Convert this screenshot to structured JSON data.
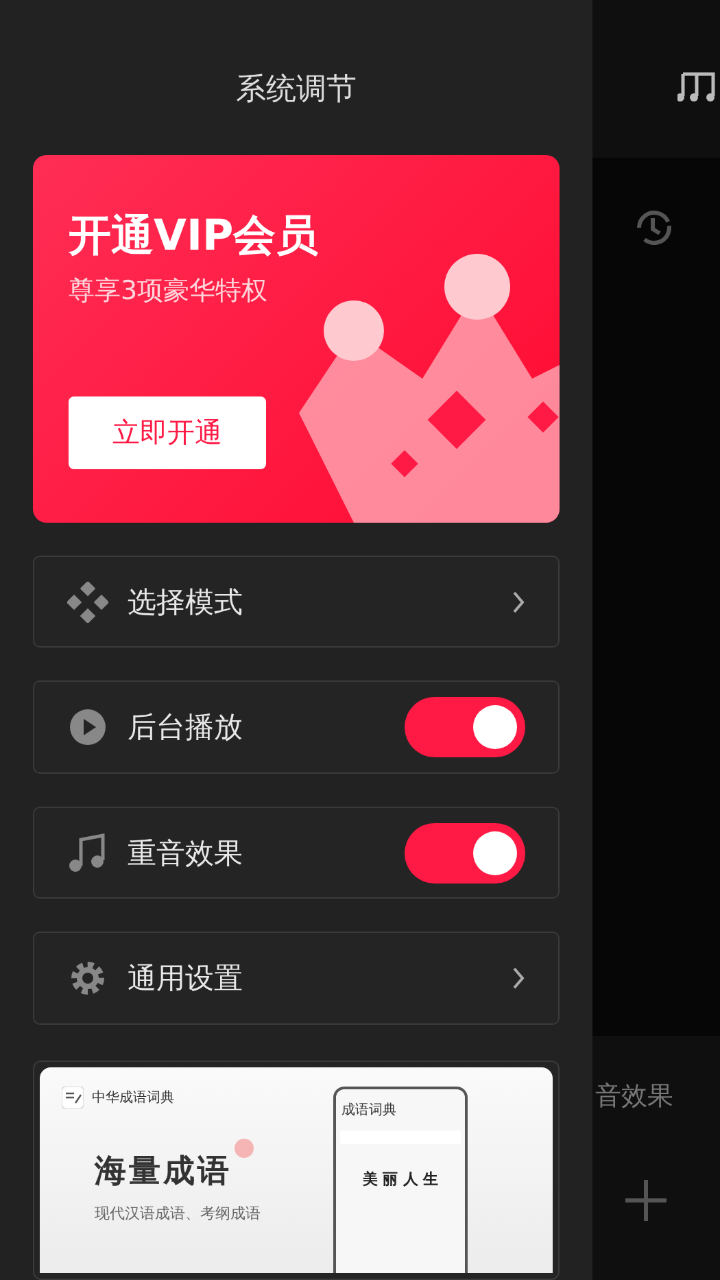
{
  "drawer": {
    "title": "系统调节",
    "vip": {
      "title": "开通VIP会员",
      "subtitle": "尊享3项豪华特权",
      "button": "立即开通"
    },
    "items": [
      {
        "kind": "chevron",
        "label": "选择模式"
      },
      {
        "kind": "toggle",
        "label": "后台播放",
        "on": true
      },
      {
        "kind": "toggle",
        "label": "重音效果",
        "on": true
      },
      {
        "kind": "chevron",
        "label": "通用设置"
      }
    ],
    "ad": {
      "brand": "中华成语词典",
      "headline": "海量成语",
      "tagline": "现代汉语成语、考纲成语",
      "phone_title": "成语词典",
      "phone_word": "美 丽 人 生"
    }
  },
  "background": {
    "label": "音效果"
  }
}
